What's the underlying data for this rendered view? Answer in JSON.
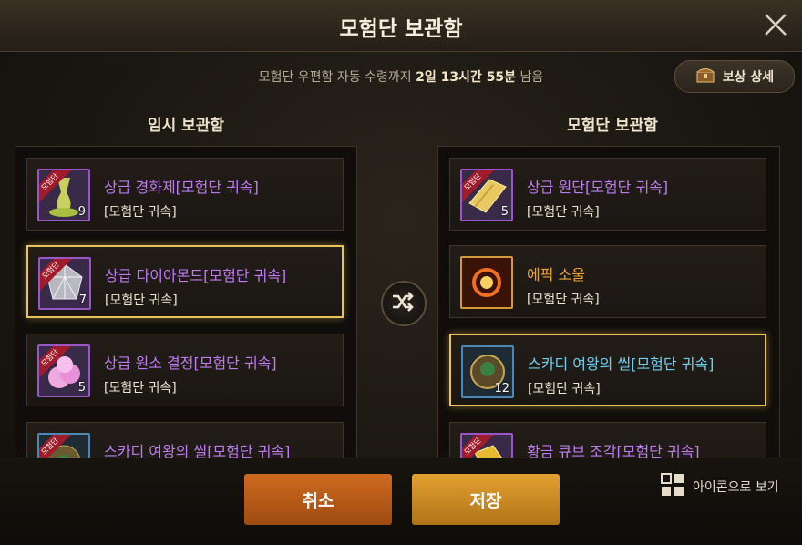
{
  "window": {
    "title": "모험단 보관함"
  },
  "notice": {
    "prefix": "모험단 우편함 자동 수령까지",
    "time": "2일 13시간 55분",
    "suffix": "남음"
  },
  "reward_button": {
    "label": "보상 상세",
    "icon": "treasure-chest-icon"
  },
  "left_panel": {
    "title": "임시 보관함",
    "items": [
      {
        "name": "상급 경화제[모험단 귀속]",
        "sub": "[모험단 귀속]",
        "qty": "9",
        "ribbon": "모험단",
        "icon": "hardener-potion-icon",
        "grade": "unique"
      },
      {
        "name": "상급 다이아몬드[모험단 귀속]",
        "sub": "[모험단 귀속]",
        "qty": "7",
        "ribbon": "모험단",
        "icon": "diamond-icon",
        "grade": "unique",
        "selected": true
      },
      {
        "name": "상급 원소 결정[모험단 귀속]",
        "sub": "[모험단 귀속]",
        "qty": "5",
        "ribbon": "모험단",
        "icon": "element-crystal-icon",
        "grade": "unique"
      },
      {
        "name": "스카디 여왕의 씰[모험단 귀속]",
        "sub": "",
        "qty": "",
        "ribbon": "모험단",
        "icon": "queen-seal-icon",
        "grade": "rare"
      }
    ]
  },
  "right_panel": {
    "title": "모험단 보관함",
    "items": [
      {
        "name": "상급 원단[모험단 귀속]",
        "sub": "[모험단 귀속]",
        "qty": "5",
        "ribbon": "모험단",
        "icon": "fabric-icon",
        "grade": "unique"
      },
      {
        "name": "에픽 소울",
        "sub": "[모험단 귀속]",
        "qty": "",
        "ribbon": "",
        "icon": "epic-soul-icon",
        "grade": "epic"
      },
      {
        "name": "스카디 여왕의 씰[모험단 귀속]",
        "sub": "[모험단 귀속]",
        "qty": "12",
        "ribbon": "",
        "icon": "queen-seal-icon",
        "grade": "rare",
        "selected": true
      },
      {
        "name": "황금 큐브 조각[모험단 귀속]",
        "sub": "",
        "qty": "",
        "ribbon": "모험단",
        "icon": "gold-cube-piece-icon",
        "grade": "unique"
      }
    ]
  },
  "buttons": {
    "cancel": "취소",
    "save": "저장"
  },
  "view_toggle": {
    "label": "아이콘으로 보기",
    "icon": "grid-view-icon"
  },
  "colors": {
    "unique": "#bf7bf0",
    "epic": "#f0a434",
    "rare": "#6fd0f0",
    "selected_border": "#e8c35a",
    "cancel": "#c2621b",
    "save": "#d9962a"
  }
}
